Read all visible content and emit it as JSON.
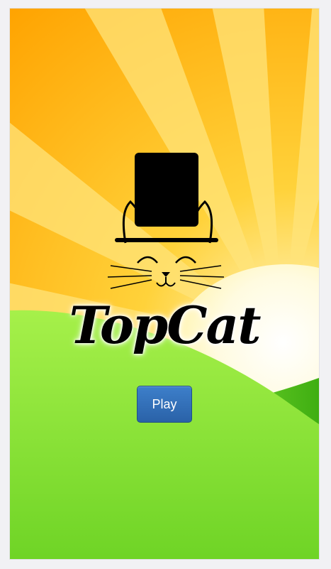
{
  "app": {
    "title": "TopCat",
    "play_label": "Play"
  },
  "icons": {
    "logo": "top-hat-cat-icon"
  },
  "colors": {
    "sky": "#ffb300",
    "ray_light": "#ffe27a",
    "sun": "#fffbe3",
    "hill_front": "#8ee63a",
    "hill_back": "#55c41e",
    "button": "#2f6db5",
    "button_text": "#ffffff",
    "title_text": "#000000"
  }
}
